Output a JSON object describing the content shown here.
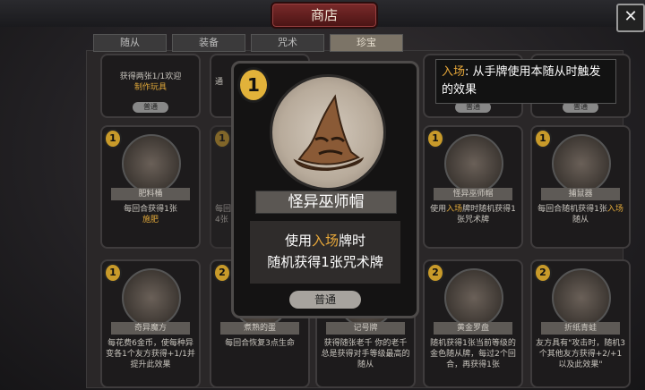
{
  "header": {
    "title": "商店",
    "close": "✕"
  },
  "tabs": [
    {
      "label": "随从"
    },
    {
      "label": "装备"
    },
    {
      "label": "咒术"
    },
    {
      "label": "珍宝"
    }
  ],
  "tooltip": {
    "keyword": "入场",
    "text": ": 从手牌使用本随从时触发的效果"
  },
  "featured": {
    "cost": "1",
    "name": "怪异巫师帽",
    "desc_pre": "使用",
    "desc_kw": "入场",
    "desc_line1_post": "牌时",
    "desc_line2": "随机获得1张咒术牌",
    "rarity": "普通"
  },
  "top_row": [
    {
      "desc_a": "获得两张1/1欢迎",
      "desc_b": "制作玩具",
      "rarity": "普通"
    },
    {
      "desc_a": "通",
      "rarity": ""
    },
    {
      "rarity": "普通"
    },
    {
      "rarity": "普通"
    }
  ],
  "row2": [
    {
      "cost": "1",
      "name": "肥料桶",
      "desc_a": "每回合获得1张",
      "desc_hl": "施肥",
      "desc_b": ""
    },
    {
      "cost": "1",
      "name": "",
      "desc_a": "每回",
      "desc_hl": "",
      "desc_b": "4张"
    },
    {
      "cost": "1",
      "name": "怪异巫师帽",
      "desc_a": "使用",
      "desc_hl": "入场",
      "desc_b": "牌时随机获得1张咒术牌"
    },
    {
      "cost": "1",
      "name": "捕鼠器",
      "desc_a": "每回合随机获得1张",
      "desc_hl": "入场",
      "desc_b": "随从"
    }
  ],
  "row3": [
    {
      "cost": "1",
      "name": "奇异魔方",
      "desc": "每花费6金币，使每种异变各1个友方获得+1/1并提升此效果"
    },
    {
      "cost": "2",
      "name": "煮熟的蛋",
      "desc": "每回合恢复3点生命"
    },
    {
      "cost": "",
      "name": "记号牌",
      "desc": "获得随张老千 你的老千总是获得对手等级最高的随从"
    },
    {
      "cost": "2",
      "name": "黄金罗盘",
      "desc": "随机获得1张当前等级的金色随从牌，每过2个回合，再获得1张"
    },
    {
      "cost": "2",
      "name": "折纸青蛙",
      "desc": "友方具有\"攻击时，随机3个其他友方获得+2/+1以及此效果\""
    }
  ],
  "colors": {
    "accent": "#e8a83a",
    "coin": "#e2b23a",
    "title_bg": "#6b2020"
  }
}
